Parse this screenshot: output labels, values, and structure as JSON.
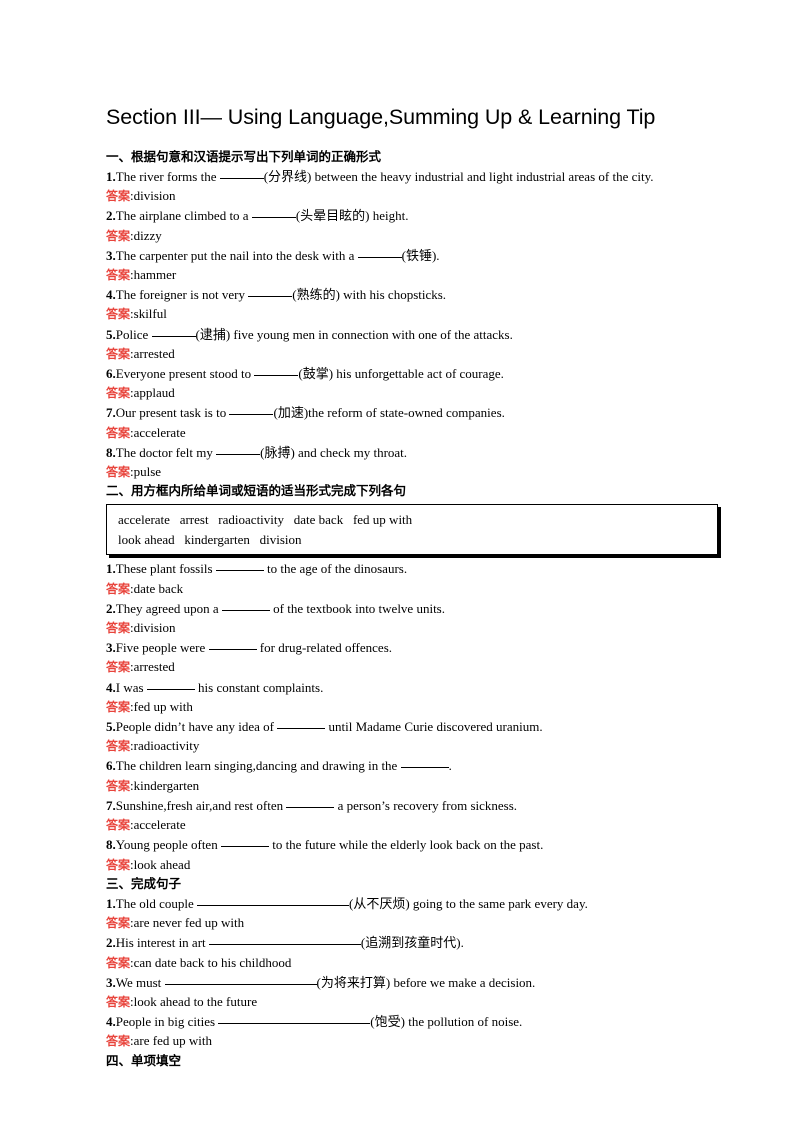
{
  "title": "Section III— Using Language,Summing Up & Learning Tip",
  "answer_label": "答案",
  "answer_color": "#e8443c",
  "sections": [
    {
      "heading": "一、根据句意和汉语提示写出下列单词的正确形式",
      "items": [
        {
          "num": "1.",
          "pre": "The river forms the ",
          "blank": "short",
          "post": "(分界线) between the heavy industrial and light industrial areas of the city.",
          "answer": "division"
        },
        {
          "num": "2.",
          "pre": "The airplane climbed to a ",
          "blank": "short",
          "post": "(头晕目眩的) height.",
          "answer": "dizzy"
        },
        {
          "num": "3.",
          "pre": "The carpenter put the nail into the desk with a ",
          "blank": "short",
          "post": "(铁锤).",
          "answer": "hammer"
        },
        {
          "num": "4.",
          "pre": "The foreigner is not very ",
          "blank": "short",
          "post": "(熟练的) with his chopsticks.",
          "answer": "skilful"
        },
        {
          "num": "5.",
          "pre": "Police ",
          "blank": "short",
          "post": "(逮捕) five young men in connection with one of the attacks.",
          "answer": "arrested"
        },
        {
          "num": "6.",
          "pre": "Everyone present stood to ",
          "blank": "short",
          "post": "(鼓掌) his unforgettable act of courage.",
          "answer": "applaud"
        },
        {
          "num": "7.",
          "pre": "Our present task is to ",
          "blank": "short",
          "post": "(加速)the reform of state-owned companies.",
          "answer": "accelerate"
        },
        {
          "num": "8.",
          "pre": "The doctor felt my ",
          "blank": "short",
          "post": "(脉搏) and check my throat.",
          "answer": "pulse"
        }
      ]
    },
    {
      "heading": "二、用方框内所给单词或短语的适当形式完成下列各句",
      "wordbox": [
        "accelerate   arrest   radioactivity   date back   fed up with",
        "look ahead   kindergarten   division"
      ],
      "items": [
        {
          "num": "1.",
          "pre": "These plant fossils ",
          "blank": "med",
          "post": " to the age of the dinosaurs.",
          "answer": "date back"
        },
        {
          "num": "2.",
          "pre": "They agreed upon a ",
          "blank": "med",
          "post": " of the textbook into twelve units.",
          "answer": "division"
        },
        {
          "num": "3.",
          "pre": "Five people were ",
          "blank": "med",
          "post": " for drug-related offences.",
          "answer": "arrested"
        },
        {
          "num": "4.",
          "pre": "I was ",
          "blank": "med",
          "post": " his constant complaints.",
          "answer": "fed up with"
        },
        {
          "num": "5.",
          "pre": "People didn’t have any idea of ",
          "blank": "med",
          "post": " until Madame Curie discovered uranium.",
          "answer": "radioactivity"
        },
        {
          "num": "6.",
          "pre": "The children learn singing,dancing and drawing in the ",
          "blank": "med",
          "post": ".",
          "answer": "kindergarten"
        },
        {
          "num": "7.",
          "pre": "Sunshine,fresh air,and rest often ",
          "blank": "med",
          "post": " a person’s recovery from sickness.",
          "answer": "accelerate"
        },
        {
          "num": "8.",
          "pre": "Young people often ",
          "blank": "med",
          "post": " to the future while the elderly look back on the past.",
          "answer": "look ahead"
        }
      ]
    },
    {
      "heading": "三、完成句子",
      "items": [
        {
          "num": "1.",
          "pre": "The old couple ",
          "blank": "long",
          "post": "(从不厌烦) going to the same park every day.",
          "answer": "are never fed up with"
        },
        {
          "num": "2.",
          "pre": "His interest in art ",
          "blank": "long",
          "post": "(追溯到孩童时代).",
          "answer": "can date back to his childhood"
        },
        {
          "num": "3.",
          "pre": "We must ",
          "blank": "long",
          "post": "(为将来打算) before we make a decision.",
          "answer": "look ahead to the future"
        },
        {
          "num": "4.",
          "pre": "People in big cities ",
          "blank": "long",
          "post": "(饱受) the pollution of noise.",
          "answer": "are fed up with"
        }
      ]
    },
    {
      "heading": "四、单项填空",
      "items": []
    }
  ]
}
